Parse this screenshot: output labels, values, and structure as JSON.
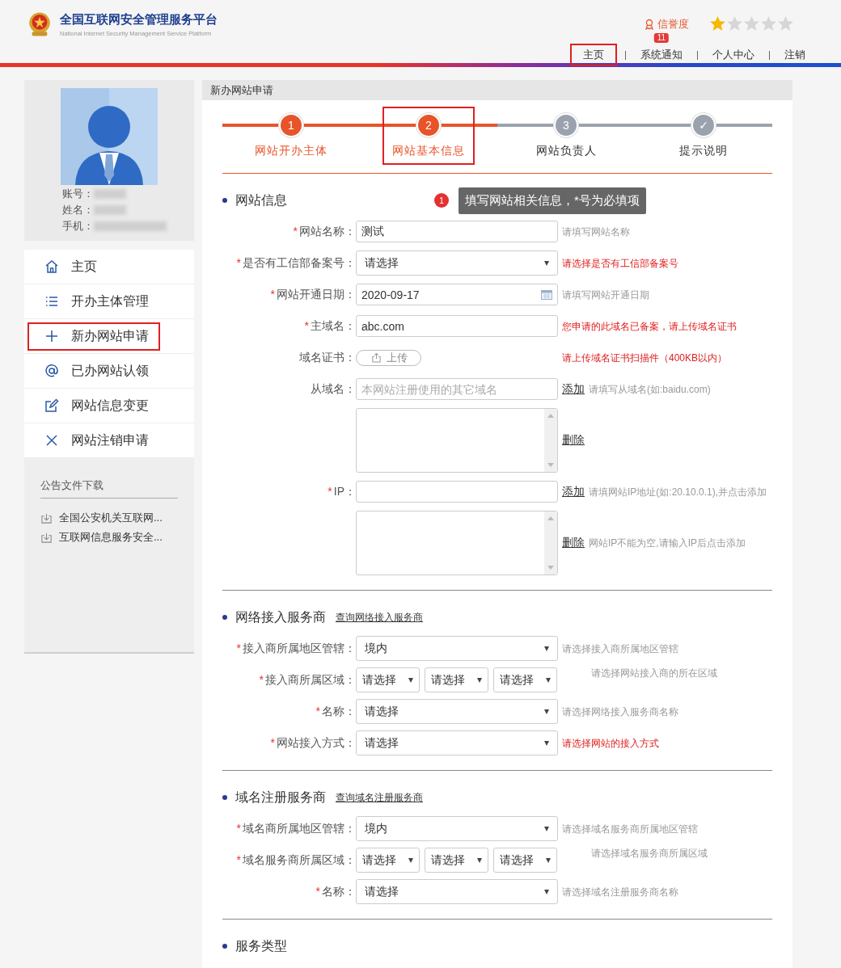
{
  "header": {
    "title": "全国互联网安全管理服务平台",
    "subtitle": "National Internet Security Management Service Platform",
    "credit_label": "信誉度",
    "stars": 1,
    "nav": [
      {
        "label": "主页",
        "annotated": true
      },
      {
        "label": "系统通知",
        "badge": "11",
        "annotated": false
      },
      {
        "label": "个人中心",
        "annotated": false
      },
      {
        "label": "注销",
        "annotated": false
      }
    ]
  },
  "profile": {
    "fields": [
      "账号：",
      "姓名：",
      "手机："
    ]
  },
  "sidebar": {
    "items": [
      {
        "kind": "home",
        "label": "主页",
        "annotated": false
      },
      {
        "kind": "list",
        "label": "开办主体管理",
        "annotated": false
      },
      {
        "kind": "plus",
        "label": "新办网站申请",
        "annotated": true
      },
      {
        "kind": "at",
        "label": "已办网站认领",
        "annotated": false
      },
      {
        "kind": "edit",
        "label": "网站信息变更",
        "annotated": false
      },
      {
        "kind": "cross",
        "label": "网站注销申请",
        "annotated": false
      }
    ]
  },
  "downloads": {
    "title": "公告文件下载",
    "items": [
      "全国公安机关互联网...",
      "互联网信息服务安全..."
    ]
  },
  "page": {
    "breadcrumb": "新办网站申请",
    "steps": [
      {
        "number": "1",
        "label": "网站开办主体",
        "active": true,
        "annotated": false
      },
      {
        "number": "2",
        "label": "网站基本信息",
        "active": true,
        "annotated": true
      },
      {
        "number": "3",
        "label": "网站负责人",
        "active": false,
        "annotated": false
      },
      {
        "number": "✓",
        "label": "提示说明",
        "active": false,
        "annotated": false
      }
    ],
    "sections": [
      {
        "title": "网站信息",
        "tip": {
          "badge": "1",
          "text": "填写网站相关信息，*号为必填项"
        },
        "rows": [
          {
            "kind": "input",
            "mark": "*",
            "label": "网站名称：",
            "value": "测试",
            "hint": "请填写网站名称",
            "error": false
          },
          {
            "kind": "select",
            "mark": "*",
            "label": "是否有工信部备案号：",
            "value": "请选择",
            "hint": "请选择是否有工信部备案号",
            "error": true
          },
          {
            "kind": "date",
            "mark": "*",
            "label": "网站开通日期：",
            "value": "2020-09-17",
            "hint": "请填写网站开通日期",
            "error": false
          },
          {
            "kind": "input",
            "mark": "*",
            "label": "主域名：",
            "value": "abc.com",
            "hint": "您申请的此域名已备案，请上传域名证书",
            "error": true
          },
          {
            "kind": "upload",
            "label": "域名证书：",
            "button": "上传",
            "hint": "请上传域名证书扫描件（400KB以内）",
            "error": true
          },
          {
            "kind": "input",
            "label": "从域名：",
            "placeholder": "本网站注册使用的其它域名",
            "action": "添加",
            "hint": "请填写从域名(如:baidu.com)",
            "error": false
          },
          {
            "kind": "textarea",
            "action": "删除"
          },
          {
            "kind": "input",
            "mark": "*",
            "label": "IP：",
            "action": "添加",
            "hint": "请填网站IP地址(如:20.10.0.1),并点击添加",
            "error": false
          },
          {
            "kind": "textarea",
            "action": "删除",
            "hint": "网站IP不能为空,请输入IP后点击添加",
            "error": false
          }
        ]
      },
      {
        "title": "网络接入服务商",
        "link": "查询网络接入服务商",
        "rows": [
          {
            "kind": "select",
            "mark": "*",
            "label": "接入商所属地区管辖：",
            "value": "境内",
            "hint": "请选择接入商所属地区管辖",
            "error": false
          },
          {
            "kind": "select3",
            "mark": "*",
            "label": "接入商所属区域：",
            "values": [
              "请选择",
              "请选择",
              "请选择"
            ],
            "hint": "请选择网站接入商的所在区域",
            "error": false
          },
          {
            "kind": "select",
            "mark": "*",
            "label": "名称：",
            "value": "请选择",
            "hint": "请选择网络接入服务商名称",
            "error": false
          },
          {
            "kind": "select",
            "mark": "*",
            "label": "网站接入方式：",
            "value": "请选择",
            "hint": "请选择网站的接入方式",
            "error": true
          }
        ]
      },
      {
        "title": "域名注册服务商",
        "link": "查询域名注册服务商",
        "rows": [
          {
            "kind": "select",
            "mark": "*",
            "label": "域名商所属地区管辖：",
            "value": "境内",
            "hint": "请选择域名服务商所属地区管辖",
            "error": false
          },
          {
            "kind": "select3",
            "mark": "*",
            "label": "域名服务商所属区域：",
            "values": [
              "请选择",
              "请选择",
              "请选择"
            ],
            "hint": "请选择域名服务商所属区域",
            "error": false
          },
          {
            "kind": "select",
            "mark": "*",
            "label": "名称：",
            "value": "请选择",
            "hint": "请选择域名注册服务商名称",
            "error": false
          }
        ]
      },
      {
        "title": "服务类型"
      }
    ]
  }
}
